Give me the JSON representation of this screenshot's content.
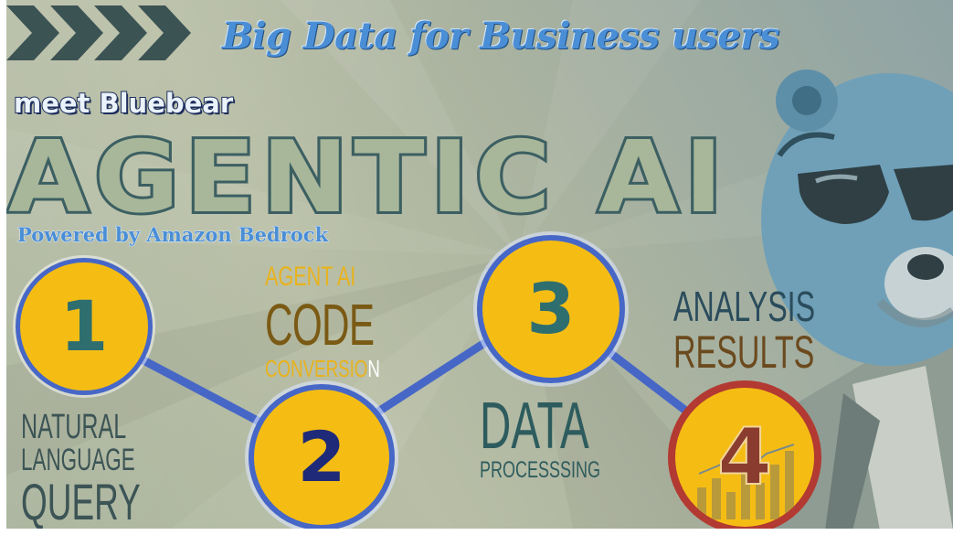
{
  "header": {
    "headline": "Big Data for Business users",
    "tagline": "meet Bluebear",
    "title": "AGENTIC AI",
    "powered_by": "Powered by Amazon Bedrock"
  },
  "steps": [
    {
      "number": "1",
      "label_lines": [
        "NATURAL",
        "LANGUAGE",
        "QUERY"
      ]
    },
    {
      "number": "2",
      "label_lines": [
        "AGENT AI",
        "CODE",
        "CONVERSIO",
        "N"
      ]
    },
    {
      "number": "3",
      "label_lines": [
        "DATA",
        "PROCESSSING"
      ]
    },
    {
      "number": "4",
      "label_lines": [
        "ANALYSIS",
        "RESULTS"
      ]
    }
  ],
  "colors": {
    "circle_fill": "#f5bd14",
    "circle_ring": "#4767c7",
    "final_ring": "#b23a32",
    "headline": "#4a8ed6"
  },
  "icons": [
    "chevron-arrows-icon",
    "bluebear-mascot-icon",
    "bar-chart-icon"
  ]
}
